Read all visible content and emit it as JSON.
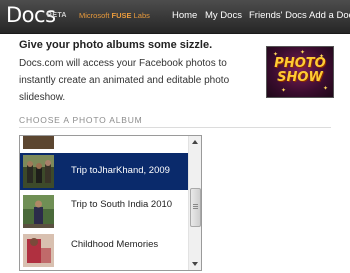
{
  "header": {
    "logo": "Docs",
    "beta": "BETA",
    "lab_prefix": "Microsoft ",
    "lab_name": "FUSE",
    "lab_suffix": " Labs",
    "nav": [
      "Home",
      "My Docs",
      "Friends' Docs",
      "Add a Doc"
    ]
  },
  "intro": {
    "headline": "Give your photo albums some sizzle.",
    "description": "Docs.com will access your Facebook photos to instantly create an animated and editable photo slideshow.",
    "promo_line1": "PHOTO",
    "promo_line2": "SHOW"
  },
  "album_picker": {
    "title": "CHOOSE A PHOTO ALBUM",
    "selected": "Trip toJharKhand, 2009",
    "items": [
      {
        "label": ""
      },
      {
        "label": "Trip toJharKhand, 2009"
      },
      {
        "label": "Trip to South India 2010"
      },
      {
        "label": "Childhood Memories"
      }
    ]
  },
  "colors": {
    "topbar": "#333333",
    "selection": "#0a2a6b",
    "fuse": "#e89a3c",
    "section_title": "#8c8c8c"
  },
  "icons": {
    "scroll_up": "triangle-up",
    "scroll_down": "triangle-down"
  }
}
